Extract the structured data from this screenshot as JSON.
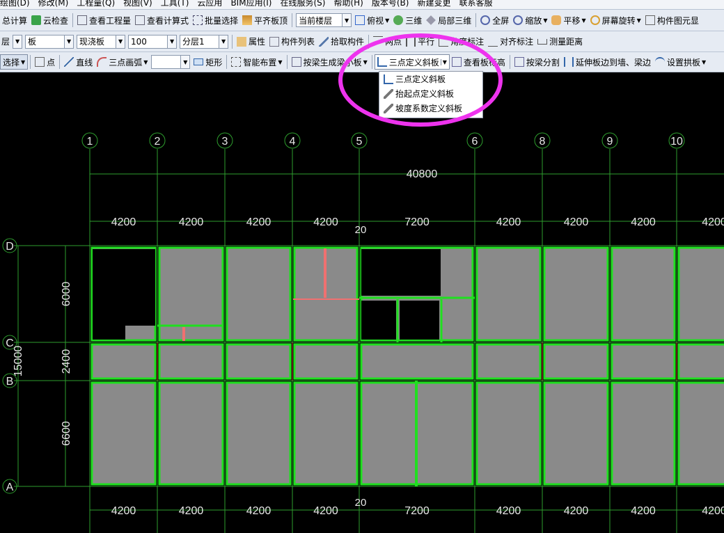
{
  "menu": [
    "绘图(D)",
    "修改(M)",
    "工程量(Q)",
    "视图(V)",
    "工具(T)",
    "云应用",
    "BIM应用(I)",
    "在线服务(S)",
    "帮助(H)",
    "版本号(B)",
    "新建变更",
    "联系客服"
  ],
  "toolbar1": {
    "calc": "总计算",
    "cloud_check": "云检查",
    "view_qty": "查看工程量",
    "view_formula": "查看计算式",
    "batch_select": "批量选择",
    "align_top": "平齐板顶",
    "floor_combo": "当前楼层",
    "top_view": "俯视",
    "three_d": "三维",
    "local_3d": "局部三维",
    "full_screen": "全屏",
    "zoom": "缩放",
    "pan": "平移",
    "rotate": "屏幕旋转",
    "component_elem": "构件图元显"
  },
  "toolbar2": {
    "layer_label": "层",
    "type_combo": "板",
    "sub_combo": "现浇板",
    "thickness_combo": "100",
    "layer_combo": "分层1",
    "properties": "属性",
    "comp_list": "构件列表",
    "pick_comp": "拾取构件",
    "two_points": "两点",
    "parallel": "平行",
    "angle_dim": "角度标注",
    "align_dim": "对齐标注",
    "measure": "测量距离"
  },
  "toolbar3": {
    "select": "选择",
    "point": "点",
    "line": "直线",
    "arc": "三点画弧",
    "rect": "矩形",
    "smart_layout": "智能布置",
    "gen_by_beam": "按梁生成梁小板",
    "slope_combo": "三点定义斜板",
    "view_elev": "查看板标高",
    "split_beam": "按梁分割",
    "extend": "延伸板边到墙、梁边",
    "arch_plate": "设置拱板"
  },
  "dropdown": [
    "三点定义斜板",
    "抬起点定义斜板",
    "坡度系数定义斜板"
  ],
  "drawing": {
    "axes_x": [
      "1",
      "2",
      "3",
      "4",
      "5",
      "6",
      "8",
      "9",
      "10"
    ],
    "axes_y": [
      "D",
      "C",
      "B",
      "A"
    ],
    "total_x": "40800",
    "spans_top": [
      "4200",
      "4200",
      "4200",
      "4200",
      "7200",
      "4200",
      "4200",
      "4200",
      "4200"
    ],
    "spans_bottom": [
      "4200",
      "4200",
      "4200",
      "4200",
      "7200",
      "4200",
      "4200",
      "4200",
      "4200"
    ],
    "offset_top": "20",
    "offset_bottom": "20",
    "spans_y": [
      "6000",
      "2400",
      "6600"
    ],
    "total_y": "15000"
  },
  "colors": {
    "canvas": "#000000",
    "grid": "#2e9e2e",
    "slab": "#8a8a8a",
    "slab_edge": "#1fe01f",
    "accent": "#ee33ee",
    "red_line": "#f07070"
  }
}
